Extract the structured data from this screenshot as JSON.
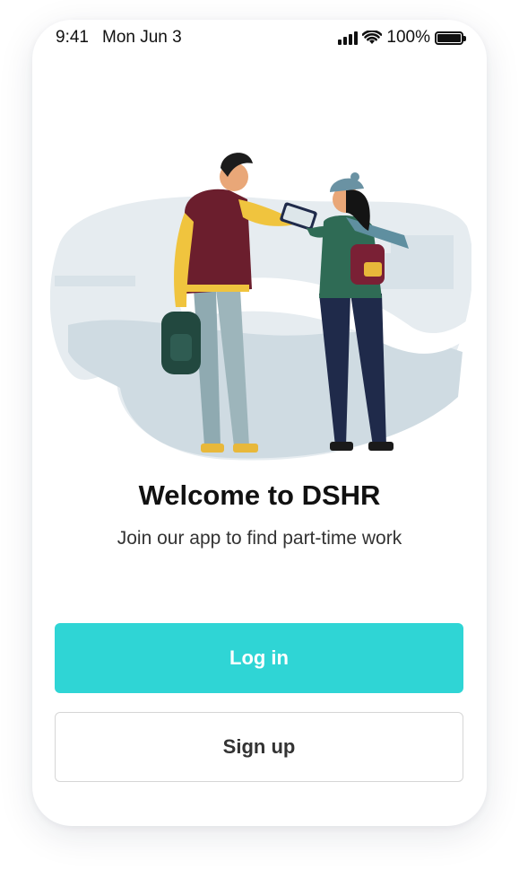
{
  "status_bar": {
    "time": "9:41",
    "date": "Mon Jun 3",
    "battery_percent": "100%"
  },
  "illustration": {
    "description_icon": "two-people-with-tablet-illustration"
  },
  "welcome": {
    "title": "Welcome to DSHR",
    "subtitle": "Join our app to find part-time work"
  },
  "buttons": {
    "login_label": "Log in",
    "signup_label": "Sign up"
  },
  "colors": {
    "accent": "#2fd5d5",
    "text": "#111111",
    "border": "#d6d6d6"
  }
}
